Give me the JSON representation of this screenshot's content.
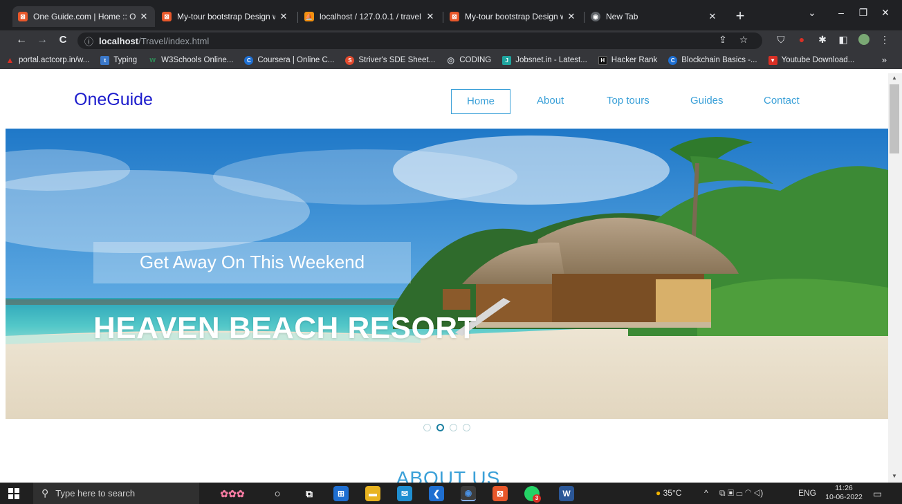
{
  "browser": {
    "tabs": [
      {
        "title": "One Guide.com | Home :: On",
        "active": true,
        "favicon_color": "#e8572a"
      },
      {
        "title": "My-tour bootstrap Design w",
        "active": false,
        "favicon_color": "#e8572a"
      },
      {
        "title": "localhost / 127.0.0.1 / travel /",
        "active": false,
        "favicon_color": "#f29111"
      },
      {
        "title": "My-tour bootstrap Design w",
        "active": false,
        "favicon_color": "#e8572a"
      },
      {
        "title": "New Tab",
        "active": false,
        "favicon_color": "#5f6368"
      }
    ],
    "new_tab_label": "+",
    "close_glyph": "✕",
    "window_controls": {
      "list": "⌄",
      "minimize": "–",
      "maximize": "❐",
      "close": "✕"
    },
    "nav": {
      "back": "←",
      "forward": "→",
      "reload": "C"
    },
    "address": {
      "info_icon": "ⓘ",
      "host": "localhost",
      "path": "/Travel/index.html"
    },
    "toolbar_icons": {
      "share": "⇪",
      "star": "☆",
      "shield": "⛉",
      "extension": "✱",
      "sidepanel": "◧",
      "menu": "⋮"
    },
    "bookmarks": [
      {
        "label": "portal.actcorp.in/w...",
        "color": "#d93025",
        "glyph": "▲"
      },
      {
        "label": "Typing",
        "color": "#3b78c9",
        "glyph": "t"
      },
      {
        "label": "W3Schools Online...",
        "color": "#2e8b57",
        "glyph": "w"
      },
      {
        "label": "Coursera | Online C...",
        "color": "#1f6fd1",
        "glyph": "C"
      },
      {
        "label": "Striver's SDE Sheet...",
        "color": "#e24a2e",
        "glyph": "S"
      },
      {
        "label": "CODING",
        "color": "#5f6368",
        "glyph": "◎"
      },
      {
        "label": "Jobsnet.in - Latest...",
        "color": "#1fa5a0",
        "glyph": "J"
      },
      {
        "label": "Hacker Rank",
        "color": "#111111",
        "glyph": "H"
      },
      {
        "label": "Blockchain Basics -...",
        "color": "#1f6fd1",
        "glyph": "C"
      },
      {
        "label": "Youtube Download...",
        "color": "#d93025",
        "glyph": "▼"
      }
    ],
    "bookmarks_more": "»"
  },
  "page": {
    "brand": "OneGuide",
    "menu": [
      {
        "label": "Home",
        "active": true
      },
      {
        "label": "About",
        "active": false
      },
      {
        "label": "Top tours",
        "active": false
      },
      {
        "label": "Guides",
        "active": false
      },
      {
        "label": "Contact",
        "active": false
      }
    ],
    "hero": {
      "subtitle": "Get Away On This Weekend",
      "title": "HEAVEN BEACH RESORT",
      "slide_count": 4,
      "active_slide": 2
    },
    "about_heading": "ABOUT US",
    "colors": {
      "brand": "#1c1ccc",
      "menu": "#3aa0d8",
      "dot_active": "#1a7fa0"
    }
  },
  "taskbar": {
    "search_placeholder": "Type here to search",
    "weather": "35°C",
    "language": "ENG",
    "time": "11:26",
    "date": "10-06-2022",
    "chrome_badge": "3"
  }
}
